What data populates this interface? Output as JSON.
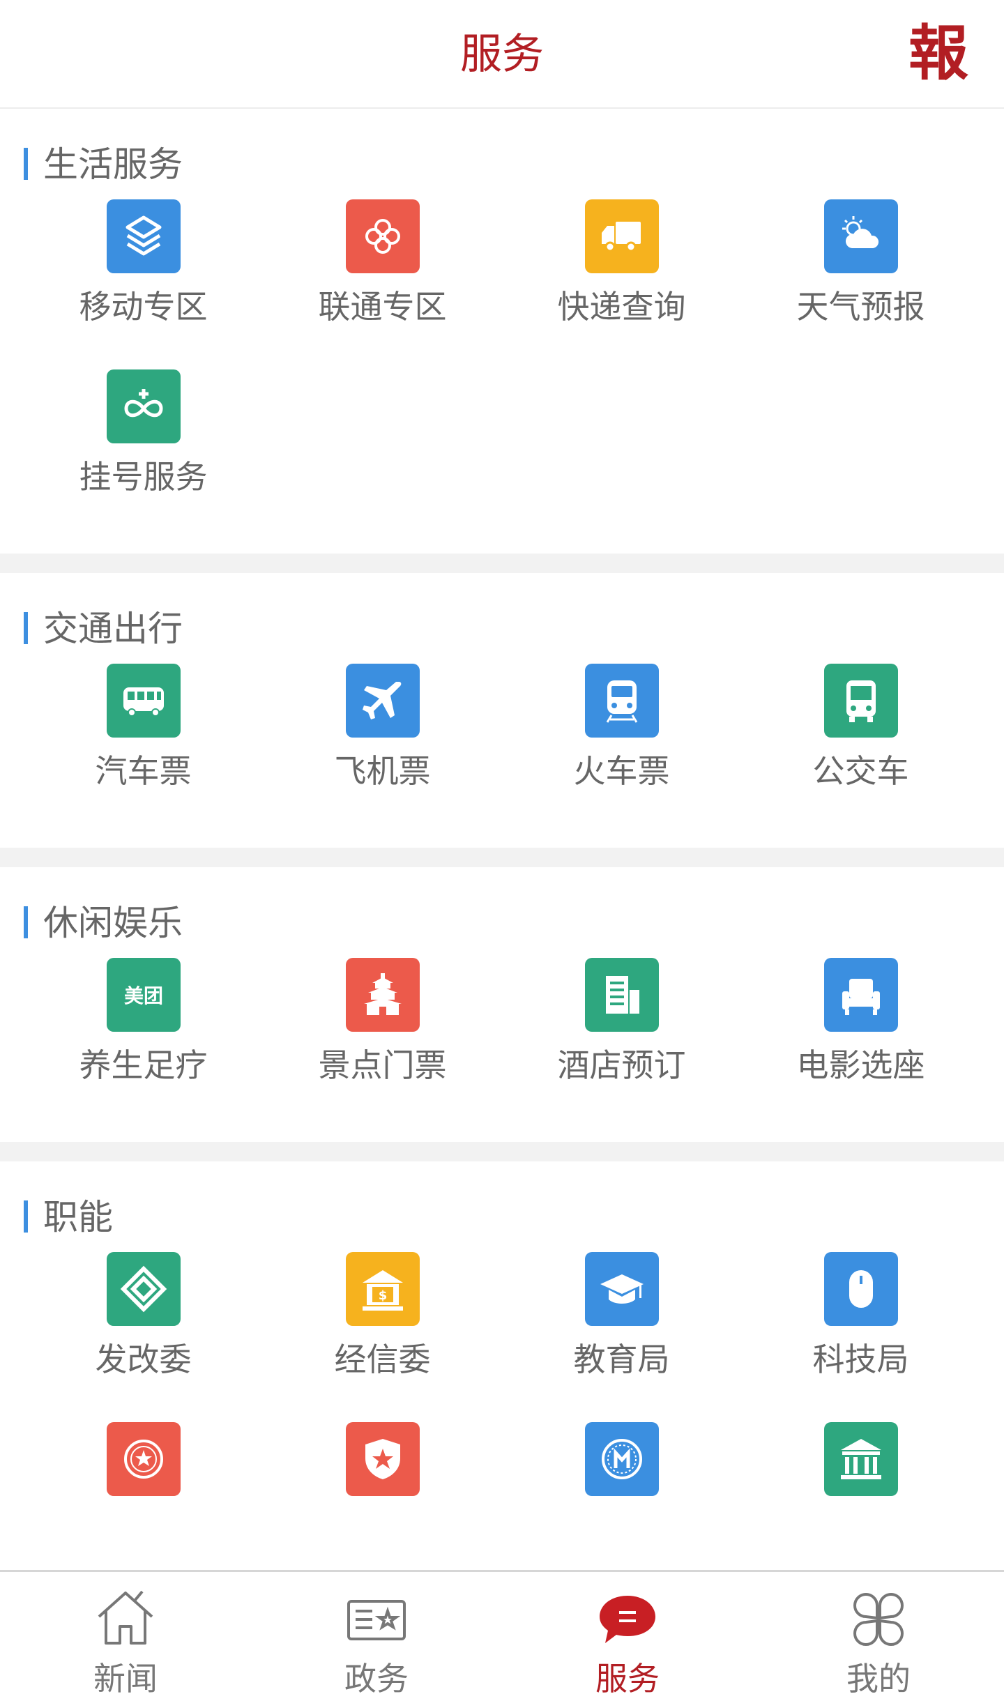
{
  "header": {
    "title": "服务",
    "logo_glyph": "報"
  },
  "colors": {
    "accent": "#b21e23",
    "section_bar": "#3d8fe0",
    "text": "#666666"
  },
  "sections": [
    {
      "title": "生活服务",
      "items": [
        {
          "label": "移动专区",
          "icon": "china-mobile-icon",
          "color": "#3b8fe0"
        },
        {
          "label": "联通专区",
          "icon": "china-unicom-icon",
          "color": "#ec5a4b"
        },
        {
          "label": "快递查询",
          "icon": "delivery-truck-icon",
          "color": "#f6b21e"
        },
        {
          "label": "天气预报",
          "icon": "weather-icon",
          "color": "#3b8fe0"
        },
        {
          "label": "挂号服务",
          "icon": "hospital-registration-icon",
          "color": "#2ea77f"
        }
      ]
    },
    {
      "title": "交通出行",
      "items": [
        {
          "label": "汽车票",
          "icon": "coach-bus-icon",
          "color": "#2ea77f"
        },
        {
          "label": "飞机票",
          "icon": "airplane-icon",
          "color": "#3b8fe0"
        },
        {
          "label": "火车票",
          "icon": "train-icon",
          "color": "#3b8fe0"
        },
        {
          "label": "公交车",
          "icon": "city-bus-icon",
          "color": "#2ea77f"
        }
      ]
    },
    {
      "title": "休闲娱乐",
      "items": [
        {
          "label": "养生足疗",
          "icon": "meituan-icon",
          "color": "#2ea77f",
          "glyph": "美团"
        },
        {
          "label": "景点门票",
          "icon": "temple-icon",
          "color": "#ec5a4b"
        },
        {
          "label": "酒店预订",
          "icon": "hotel-building-icon",
          "color": "#2ea77f"
        },
        {
          "label": "电影选座",
          "icon": "cinema-seat-icon",
          "color": "#3b8fe0"
        }
      ]
    },
    {
      "title": "职能",
      "items": [
        {
          "label": "发改委",
          "icon": "reform-commission-icon",
          "color": "#2ea77f"
        },
        {
          "label": "经信委",
          "icon": "economy-bank-icon",
          "color": "#f6b21e"
        },
        {
          "label": "教育局",
          "icon": "graduation-cap-icon",
          "color": "#3b8fe0"
        },
        {
          "label": "科技局",
          "icon": "mouse-icon",
          "color": "#3b8fe0"
        },
        {
          "label": "",
          "icon": "party-emblem-icon",
          "color": "#ec5a4b"
        },
        {
          "label": "",
          "icon": "police-badge-icon",
          "color": "#ec5a4b"
        },
        {
          "label": "",
          "icon": "court-emblem-icon",
          "color": "#3b8fe0"
        },
        {
          "label": "",
          "icon": "government-building-icon",
          "color": "#2ea77f"
        }
      ]
    }
  ],
  "tabs": [
    {
      "label": "新闻",
      "icon": "home-icon",
      "active": false
    },
    {
      "label": "政务",
      "icon": "id-card-star-icon",
      "active": false
    },
    {
      "label": "服务",
      "icon": "chat-bubble-icon",
      "active": true
    },
    {
      "label": "我的",
      "icon": "clover-grid-icon",
      "active": false
    }
  ]
}
